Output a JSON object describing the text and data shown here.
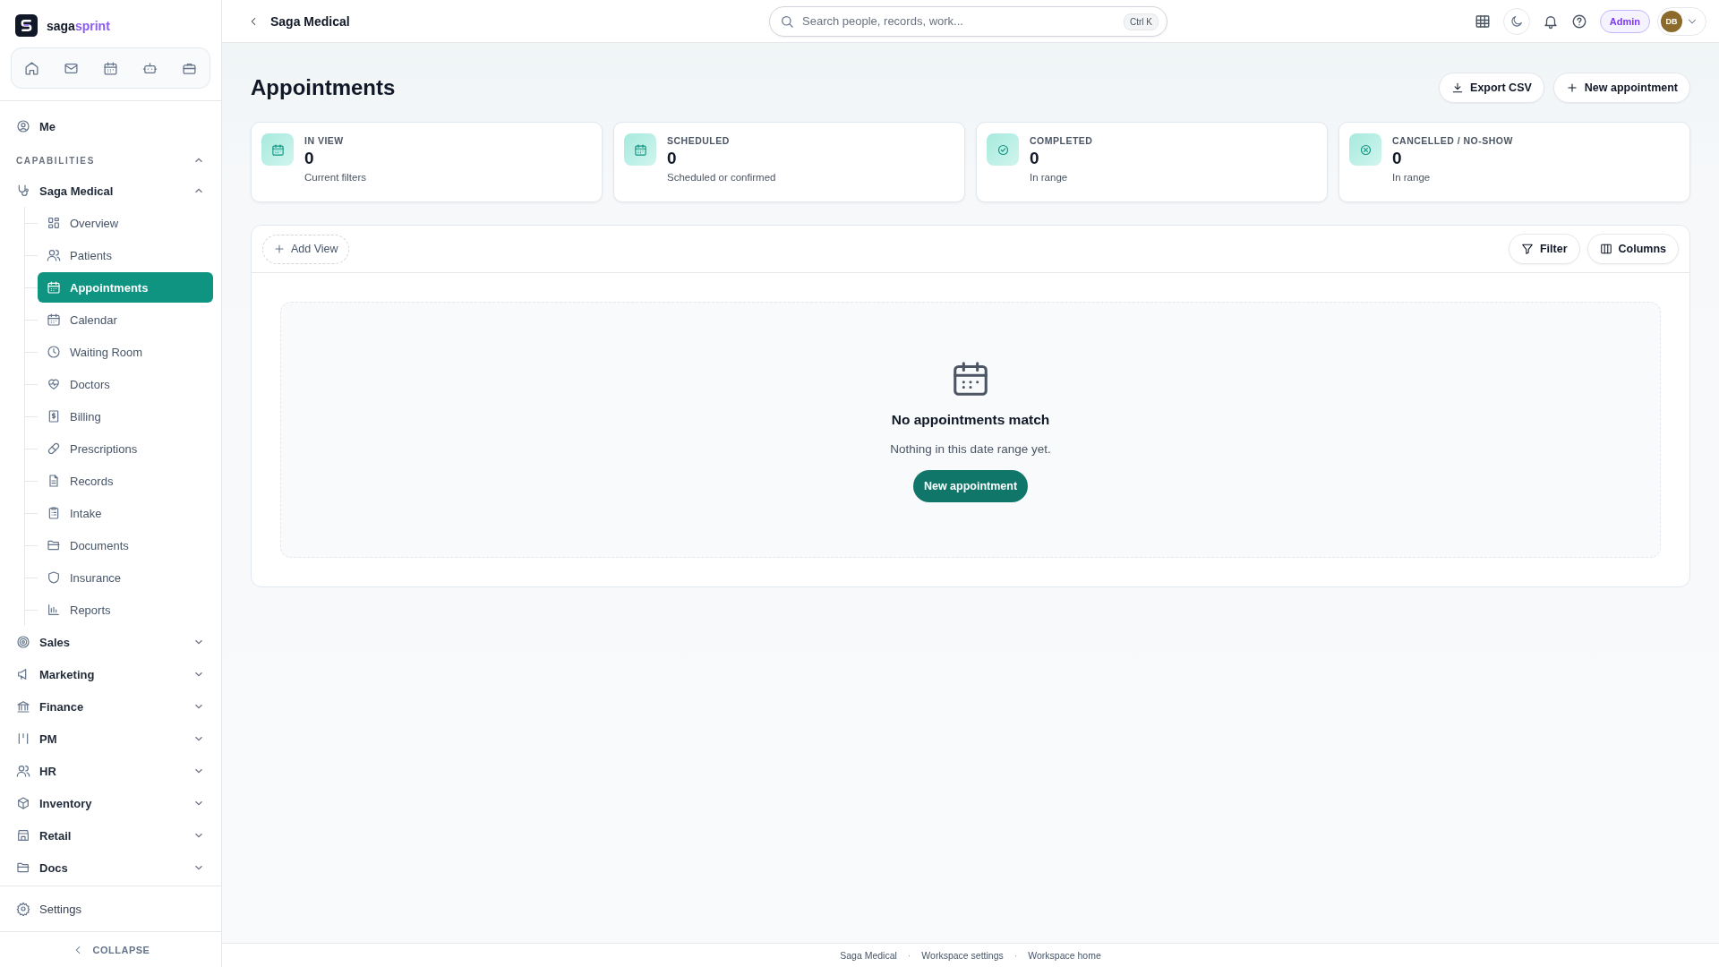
{
  "brand": {
    "name_a": "saga",
    "name_b": "sprint"
  },
  "sidebar": {
    "me": "Me",
    "section": {
      "label": "CAPABILITIES",
      "expanded": true
    },
    "groups": [
      {
        "label": "Saga Medical",
        "expanded": true,
        "children": [
          {
            "label": "Overview",
            "selected": false
          },
          {
            "label": "Patients",
            "selected": false
          },
          {
            "label": "Appointments",
            "selected": true
          },
          {
            "label": "Calendar",
            "selected": false
          },
          {
            "label": "Waiting Room",
            "selected": false
          },
          {
            "label": "Doctors",
            "selected": false
          },
          {
            "label": "Billing",
            "selected": false
          },
          {
            "label": "Prescriptions",
            "selected": false
          },
          {
            "label": "Records",
            "selected": false
          },
          {
            "label": "Intake",
            "selected": false
          },
          {
            "label": "Documents",
            "selected": false
          },
          {
            "label": "Insurance",
            "selected": false
          },
          {
            "label": "Reports",
            "selected": false
          }
        ]
      },
      {
        "label": "Sales",
        "expanded": false
      },
      {
        "label": "Marketing",
        "expanded": false
      },
      {
        "label": "Finance",
        "expanded": false
      },
      {
        "label": "PM",
        "expanded": false
      },
      {
        "label": "HR",
        "expanded": false
      },
      {
        "label": "Inventory",
        "expanded": false
      },
      {
        "label": "Retail",
        "expanded": false
      },
      {
        "label": "Docs",
        "expanded": false
      }
    ],
    "settings": "Settings",
    "collapse": "COLLAPSE"
  },
  "topbar": {
    "title": "Saga Medical",
    "search": {
      "placeholder": "Search people, records, work...",
      "shortcut": "Ctrl K"
    },
    "role": "Admin",
    "avatar": "DB"
  },
  "page": {
    "title": "Appointments",
    "actions": [
      "Export CSV",
      "New appointment"
    ]
  },
  "stats": [
    {
      "label": "IN VIEW",
      "value": "0",
      "caption": "Current filters"
    },
    {
      "label": "SCHEDULED",
      "value": "0",
      "caption": "Scheduled or confirmed"
    },
    {
      "label": "COMPLETED",
      "value": "0",
      "caption": "In range"
    },
    {
      "label": "CANCELLED / NO-SHOW",
      "value": "0",
      "caption": "In range"
    }
  ],
  "view_bar": {
    "add_view": "Add View",
    "buttons": [
      "Filter",
      "Columns"
    ]
  },
  "empty": {
    "title": "No appointments match",
    "text": "Nothing in this date range yet.",
    "button": "New appointment"
  },
  "footer": {
    "separator": "·",
    "links": [
      "Saga Medical",
      "Workspace settings",
      "Workspace home"
    ]
  }
}
